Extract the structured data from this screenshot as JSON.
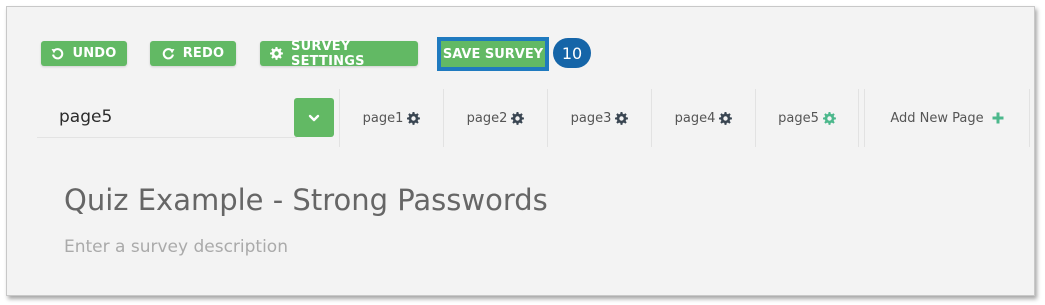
{
  "toolbar": {
    "undo_label": "UNDO",
    "redo_label": "REDO",
    "settings_label": "SURVEY SETTINGS",
    "save_label": "SAVE SURVEY",
    "callout_number": "10"
  },
  "page_selector": {
    "selected": "page5"
  },
  "tabs": [
    {
      "label": "page1",
      "icon": "gear-icon"
    },
    {
      "label": "page2",
      "icon": "gear-icon"
    },
    {
      "label": "page3",
      "icon": "gear-icon"
    },
    {
      "label": "page4",
      "icon": "gear-icon"
    },
    {
      "label": "page5",
      "icon": "gear-icon",
      "active": true
    }
  ],
  "add_page_label": "Add New Page",
  "survey": {
    "title": "Quiz Example - Strong Passwords",
    "description_placeholder": "Enter a survey description"
  },
  "colors": {
    "accent_green": "#62b964",
    "highlight_blue": "#1f7abf",
    "callout_blue": "#1565a8"
  }
}
